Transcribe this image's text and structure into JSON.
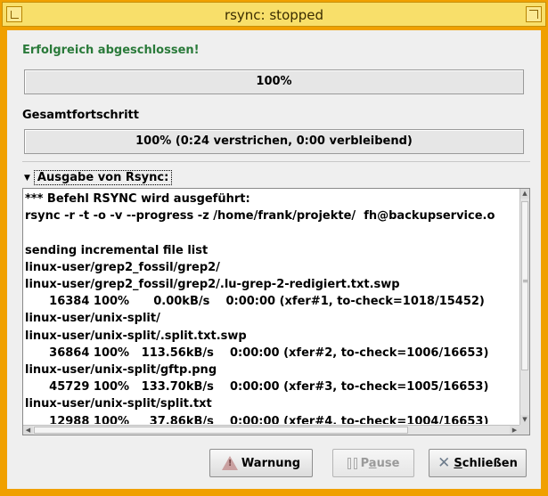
{
  "window": {
    "title": "rsync: stopped"
  },
  "status_text": "Erfolgreich abgeschlossen!",
  "file_progress": {
    "text": "100%",
    "value": 100
  },
  "total_label": "Gesamtfortschritt",
  "total_progress": {
    "text": "100%  (0:24 verstrichen,  0:00 verbleibend)",
    "value": 100
  },
  "output": {
    "expander_label": "Ausgabe von Rsync:",
    "lines": [
      "*** Befehl RSYNC wird ausgeführt:",
      "rsync -r -t -o -v --progress -z /home/frank/projekte/  fh@backupservice.o",
      "",
      "sending incremental file list",
      "linux-user/grep2_fossil/grep2/",
      "linux-user/grep2_fossil/grep2/.lu-grep-2-redigiert.txt.swp",
      "      16384 100%      0.00kB/s    0:00:00 (xfer#1, to-check=1018/15452)",
      "linux-user/unix-split/",
      "linux-user/unix-split/.split.txt.swp",
      "      36864 100%   113.56kB/s    0:00:00 (xfer#2, to-check=1006/16653)",
      "linux-user/unix-split/gftp.png",
      "      45729 100%   133.70kB/s    0:00:00 (xfer#3, to-check=1005/16653)",
      "linux-user/unix-split/split.txt",
      "      12988 100%     37.86kB/s    0:00:00 (xfer#4, to-check=1004/16653)"
    ]
  },
  "buttons": {
    "warn": {
      "label": "Warnung",
      "icon": "warning-icon"
    },
    "pause": {
      "pre": "P",
      "accel": "a",
      "post": "use",
      "icon": "pause-icon"
    },
    "close": {
      "accel": "S",
      "rest": "chließen",
      "icon": "close-icon"
    }
  },
  "colors": {
    "frame": "#f0a000",
    "titlebar": "#f8df6a",
    "status": "#2a7a3a"
  }
}
